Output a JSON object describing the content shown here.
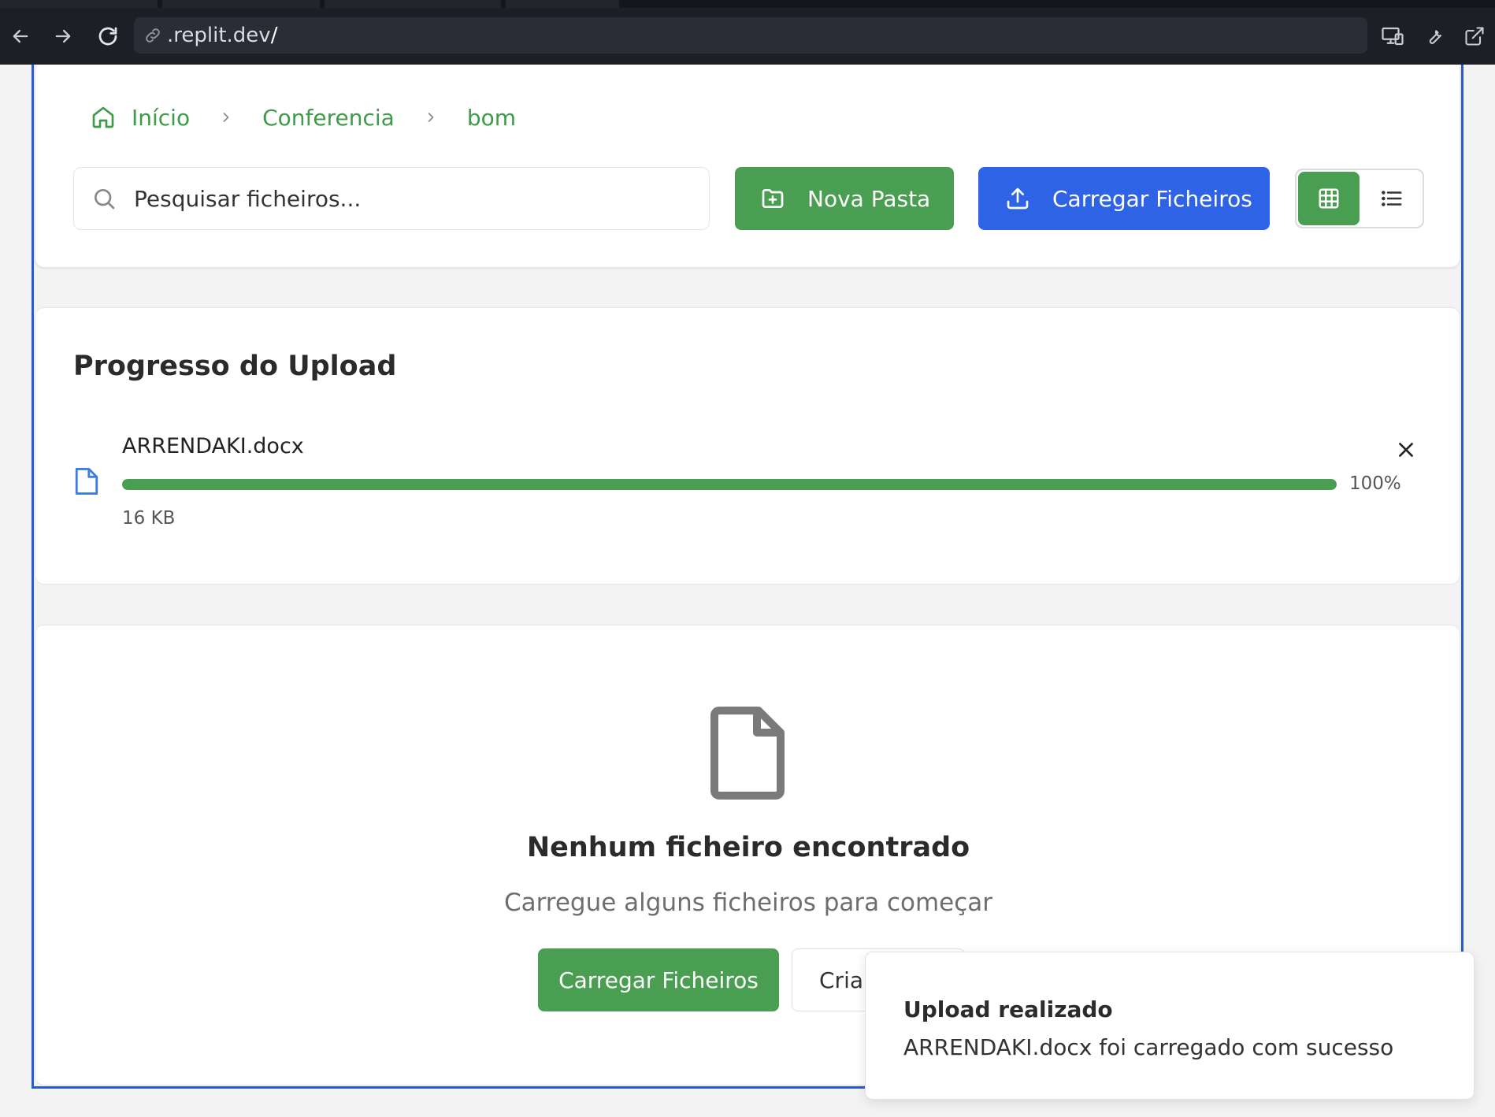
{
  "browser": {
    "url": ".replit.dev",
    "url_cursor": "/"
  },
  "breadcrumb": [
    {
      "label": "Início"
    },
    {
      "label": "Conferencia"
    },
    {
      "label": "bom"
    }
  ],
  "toolbar": {
    "search_placeholder": "Pesquisar ficheiros...",
    "new_folder_label": "Nova Pasta",
    "upload_label": "Carregar Ficheiros",
    "active_view": "grid"
  },
  "upload_progress": {
    "title": "Progresso do Upload",
    "file_name": "ARRENDAKI.docx",
    "percent_label": "100%",
    "percent_value": 100,
    "size": "16 KB"
  },
  "empty_state": {
    "title": "Nenhum ficheiro encontrado",
    "subtitle": "Carregue alguns ficheiros para começar",
    "upload_button": "Carregar Ficheiros",
    "create_button": "Criar"
  },
  "toast": {
    "title": "Upload realizado",
    "message": "ARRENDAKI.docx foi carregado com sucesso"
  },
  "colors": {
    "green": "#4a9e52",
    "blue": "#2f63e6",
    "frame_border": "#2a5bd7"
  }
}
